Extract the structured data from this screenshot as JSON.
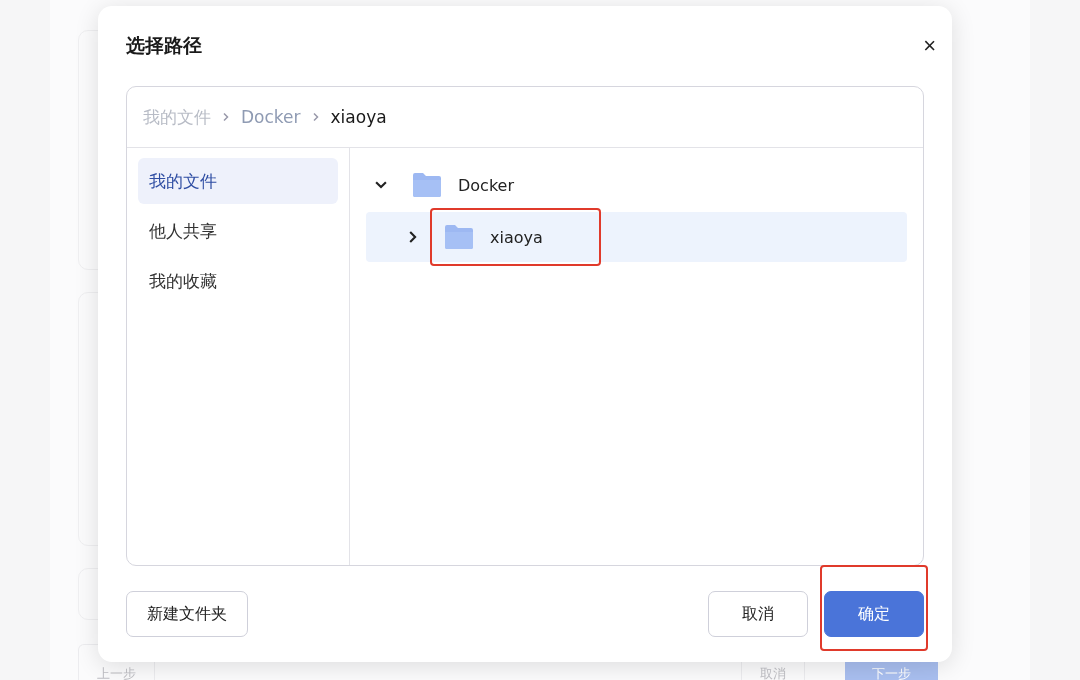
{
  "background": {
    "footer_buttons": [
      {
        "label": "上一步",
        "kind": "plain"
      },
      {
        "label": "取消",
        "kind": "plain"
      },
      {
        "label": "下一步",
        "kind": "primary"
      }
    ]
  },
  "dialog": {
    "title": "选择路径",
    "close": "×",
    "breadcrumb": [
      {
        "label": "我的文件",
        "current": false
      },
      {
        "label": "Docker",
        "current": false
      },
      {
        "label": "xiaoya",
        "current": true
      }
    ],
    "sidebar": {
      "items": [
        {
          "label": "我的文件",
          "selected": true
        },
        {
          "label": "他人共享",
          "selected": false
        },
        {
          "label": "我的收藏",
          "selected": false
        }
      ]
    },
    "tree": [
      {
        "label": "Docker",
        "expanded": true,
        "selected": false,
        "annotated": false,
        "children": [
          {
            "label": "xiaoya",
            "expanded": false,
            "selected": true,
            "annotated": true
          }
        ]
      }
    ],
    "buttons": [
      {
        "label": "新建文件夹",
        "kind": "secondary",
        "annotated": false
      },
      {
        "label": "取消",
        "kind": "secondary",
        "annotated": false
      },
      {
        "label": "确定",
        "kind": "primary",
        "annotated": true
      }
    ]
  }
}
